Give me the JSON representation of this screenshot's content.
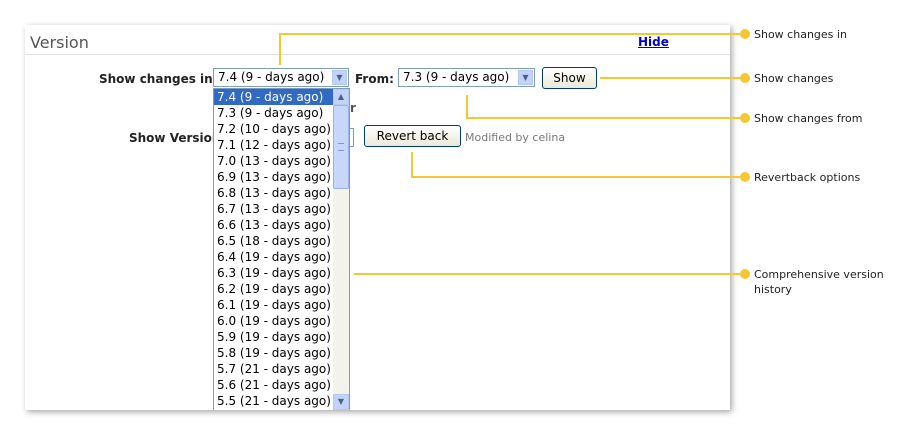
{
  "panel": {
    "title": "Version",
    "hide_link": "Hide",
    "show_changes_label": "Show changes in",
    "show_changes_value": "7.4 (9 - days ago)",
    "from_label": "From:",
    "from_value": "7.3 (9 - days ago)",
    "show_button": "Show",
    "show_version_label": "Show Version",
    "revert_button": "Revert back",
    "modified_by": "Modified by celina",
    "peek_char": "r"
  },
  "version_list": {
    "items": [
      "7.4 (9 - days ago)",
      "7.3 (9 - days ago)",
      "7.2 (10 - days ago)",
      "7.1 (12 - days ago)",
      "7.0 (13 - days ago)",
      "6.9 (13 - days ago)",
      "6.8 (13 - days ago)",
      "6.7 (13 - days ago)",
      "6.6 (13 - days ago)",
      "6.5 (18 - days ago)",
      "6.4 (19 - days ago)",
      "6.3 (19 - days ago)",
      "6.2 (19 - days ago)",
      "6.1 (19 - days ago)",
      "6.0 (19 - days ago)",
      "5.9 (19 - days ago)",
      "5.8 (19 - days ago)",
      "5.7 (21 - days ago)",
      "5.6 (21 - days ago)",
      "5.5 (21 - days ago)"
    ],
    "selected": "7.4 (9 - days ago)"
  },
  "callouts": {
    "show_changes_in": "Show changes in",
    "show_changes": "Show changes",
    "show_changes_from": "Show changes from",
    "revertback_options": "Revertback options",
    "history_line1": "Comprehensive version",
    "history_line2": "history"
  },
  "colors": {
    "callout": "#f7c733",
    "selected_bg": "#316ac5",
    "link": "#0000cc"
  }
}
